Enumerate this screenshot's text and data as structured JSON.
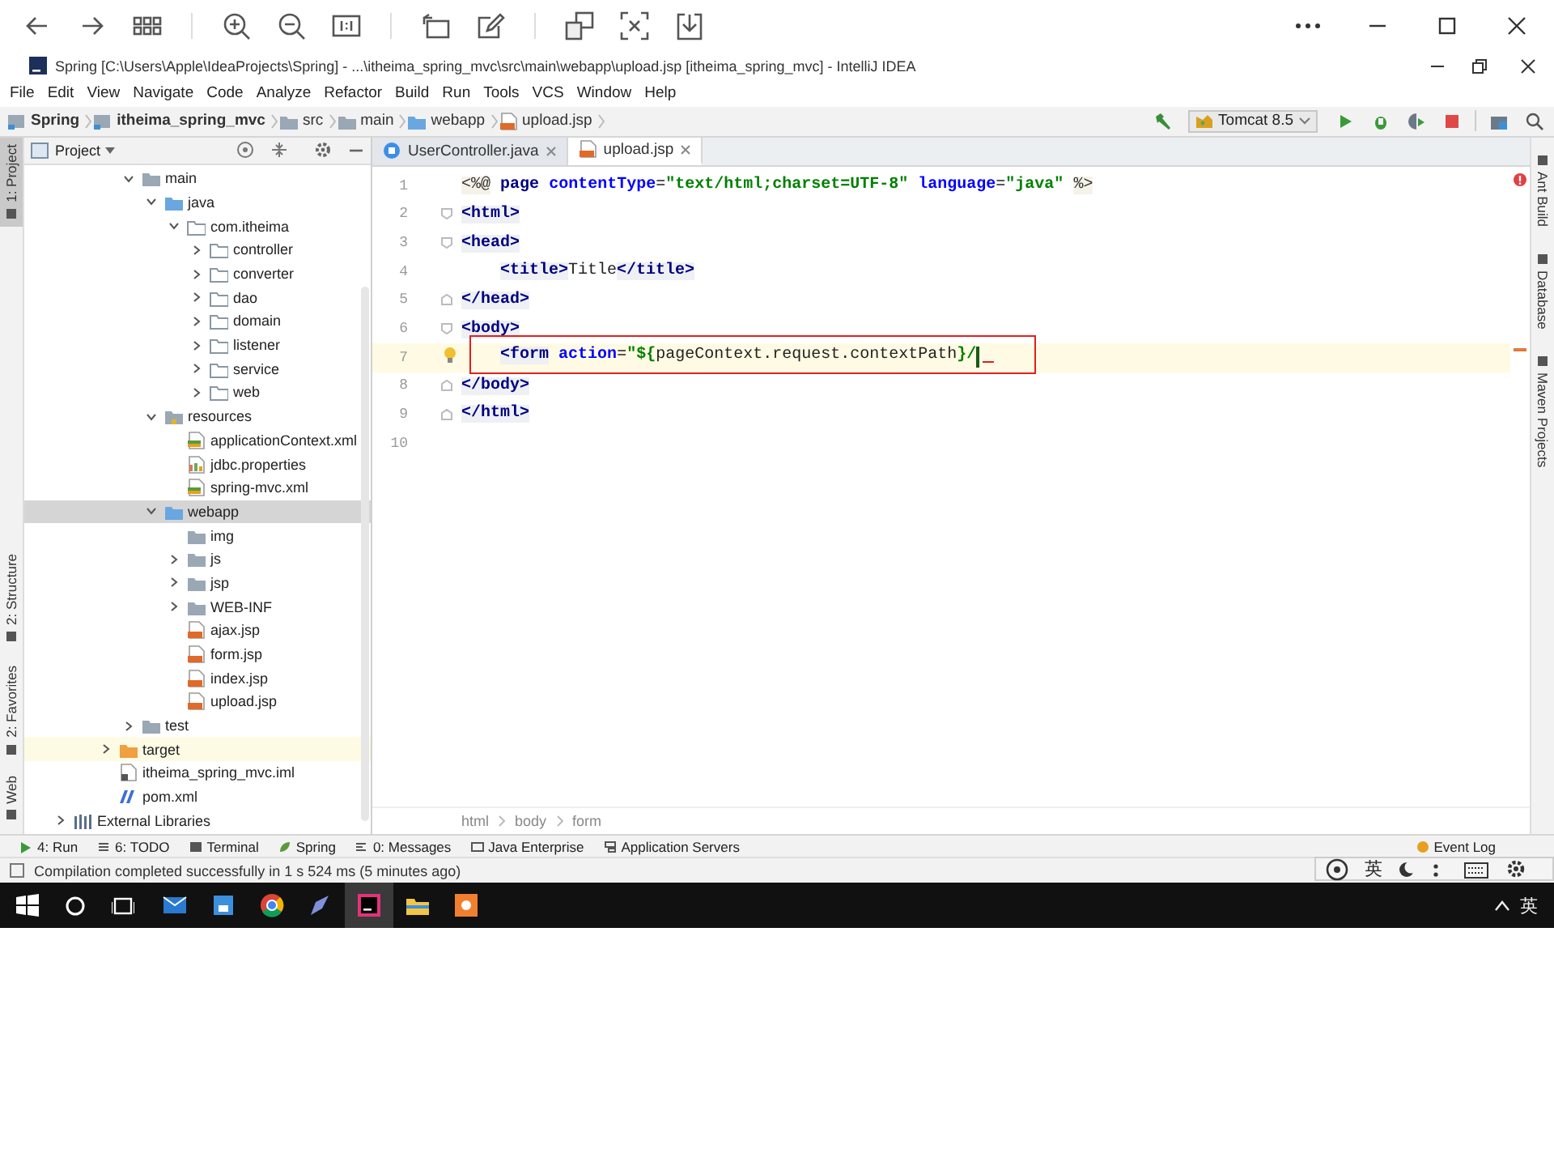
{
  "window": {
    "title": "Spring [C:\\Users\\Apple\\IdeaProjects\\Spring] - ...\\itheima_spring_mvc\\src\\main\\webapp\\upload.jsp [itheima_spring_mvc] - IntelliJ IDEA"
  },
  "menu": [
    "File",
    "Edit",
    "View",
    "Navigate",
    "Code",
    "Analyze",
    "Refactor",
    "Build",
    "Run",
    "Tools",
    "VCS",
    "Window",
    "Help"
  ],
  "breadcrumb": [
    {
      "label": "Spring",
      "kind": "module"
    },
    {
      "label": "itheima_spring_mvc",
      "kind": "module"
    },
    {
      "label": "src",
      "kind": "folder"
    },
    {
      "label": "main",
      "kind": "folder"
    },
    {
      "label": "webapp",
      "kind": "web"
    },
    {
      "label": "upload.jsp",
      "kind": "jsp"
    }
  ],
  "run_config": {
    "label": "Tomcat 8.5"
  },
  "left_tool_tabs": [
    {
      "label": "1: Project",
      "selected": true
    },
    {
      "label": "2: Structure",
      "selected": false
    },
    {
      "label": "2: Favorites",
      "selected": false
    },
    {
      "label": "Web",
      "selected": false
    }
  ],
  "right_tool_tabs": [
    {
      "label": "Ant Build"
    },
    {
      "label": "Database"
    },
    {
      "label": "Maven Projects"
    }
  ],
  "project_panel": {
    "title": "Project",
    "src_items": [
      {
        "label": "main",
        "kind": "folder",
        "expanded": true,
        "selected": false,
        "children": [
          {
            "label": "java",
            "kind": "source",
            "expanded": true,
            "selected": false,
            "children": [
              {
                "label": "com.itheima",
                "kind": "package",
                "expanded": true,
                "selected": false,
                "children": [
                  {
                    "label": "controller",
                    "kind": "package",
                    "expanded": false,
                    "selected": false
                  },
                  {
                    "label": "converter",
                    "kind": "package",
                    "expanded": false,
                    "selected": false
                  },
                  {
                    "label": "dao",
                    "kind": "package",
                    "expanded": false,
                    "selected": false
                  },
                  {
                    "label": "domain",
                    "kind": "package",
                    "expanded": false,
                    "selected": false
                  },
                  {
                    "label": "listener",
                    "kind": "package",
                    "expanded": false,
                    "selected": false
                  },
                  {
                    "label": "service",
                    "kind": "package",
                    "expanded": false,
                    "selected": false
                  },
                  {
                    "label": "web",
                    "kind": "package",
                    "expanded": false,
                    "selected": false
                  }
                ]
              }
            ]
          },
          {
            "label": "resources",
            "kind": "resources",
            "expanded": true,
            "selected": false,
            "children": [
              {
                "label": "applicationContext.xml",
                "kind": "xml",
                "selected": false
              },
              {
                "label": "jdbc.properties",
                "kind": "properties",
                "selected": false
              },
              {
                "label": "spring-mvc.xml",
                "kind": "xml",
                "selected": false
              }
            ]
          },
          {
            "label": "webapp",
            "kind": "web",
            "expanded": true,
            "selected": true,
            "children": [
              {
                "label": "img",
                "kind": "folder",
                "selected": false
              },
              {
                "label": "js",
                "kind": "folder",
                "expanded": false,
                "selected": false
              },
              {
                "label": "jsp",
                "kind": "folder",
                "expanded": false,
                "selected": false
              },
              {
                "label": "WEB-INF",
                "kind": "folder",
                "expanded": false,
                "selected": false
              },
              {
                "label": "ajax.jsp",
                "kind": "jsp",
                "selected": false
              },
              {
                "label": "form.jsp",
                "kind": "jsp",
                "selected": false
              },
              {
                "label": "index.jsp",
                "kind": "jsp",
                "selected": false
              },
              {
                "label": "upload.jsp",
                "kind": "jsp",
                "selected": false
              }
            ]
          }
        ]
      },
      {
        "label": "test",
        "kind": "folder",
        "expanded": false,
        "selected": false
      }
    ],
    "module_items": [
      {
        "label": "target",
        "kind": "excluded",
        "expanded": false,
        "selected": false
      },
      {
        "label": "itheima_spring_mvc.iml",
        "kind": "iml",
        "selected": false
      },
      {
        "label": "pom.xml",
        "kind": "pom",
        "selected": false
      }
    ],
    "root_items": [
      {
        "label": "External Libraries",
        "kind": "libraries",
        "expanded": false,
        "selected": false
      }
    ]
  },
  "editor": {
    "tabs": [
      {
        "label": "UserController.java",
        "kind": "java",
        "selected": false
      },
      {
        "label": "upload.jsp",
        "kind": "jsp",
        "selected": true
      }
    ],
    "lines": [
      {
        "number": "1",
        "fold_start": false,
        "fold_end": false,
        "current": false,
        "framed": false,
        "bulb": false,
        "error": false,
        "tokens": [
          {
            "kind": "directive",
            "t": "<%@"
          },
          {
            "kind": "keyword",
            "t": " page"
          },
          {
            "kind": "attribute",
            "t": " contentType"
          },
          {
            "kind": "plain",
            "t": "="
          },
          {
            "kind": "string",
            "t": "\"text/html;charset=UTF-8\""
          },
          {
            "kind": "attribute",
            "t": " language"
          },
          {
            "kind": "plain",
            "t": "="
          },
          {
            "kind": "string",
            "t": "\"java\""
          },
          {
            "kind": "directive",
            "t": " %>"
          }
        ]
      },
      {
        "number": "2",
        "fold_start": true,
        "fold_end": false,
        "current": false,
        "framed": false,
        "bulb": false,
        "error": false,
        "tokens": [
          {
            "kind": "tag",
            "t": "<html>"
          }
        ]
      },
      {
        "number": "3",
        "fold_start": true,
        "fold_end": false,
        "current": false,
        "framed": false,
        "bulb": false,
        "error": false,
        "tokens": [
          {
            "kind": "tag",
            "t": "<head>"
          }
        ]
      },
      {
        "number": "4",
        "fold_start": false,
        "fold_end": false,
        "current": false,
        "framed": false,
        "bulb": false,
        "error": false,
        "tokens": [
          {
            "kind": "tag",
            "t": "    <title>"
          },
          {
            "kind": "plain",
            "t": "Title"
          },
          {
            "kind": "tag",
            "t": "</title>"
          }
        ]
      },
      {
        "number": "5",
        "fold_start": false,
        "fold_end": true,
        "current": false,
        "framed": false,
        "bulb": false,
        "error": false,
        "tokens": [
          {
            "kind": "tag",
            "t": "</head>"
          }
        ]
      },
      {
        "number": "6",
        "fold_start": true,
        "fold_end": false,
        "current": false,
        "framed": false,
        "bulb": false,
        "error": false,
        "tokens": [
          {
            "kind": "tag",
            "t": "<body>"
          }
        ]
      },
      {
        "number": "7",
        "fold_start": false,
        "fold_end": false,
        "current": true,
        "framed": true,
        "bulb": true,
        "error": true,
        "tokens": [
          {
            "kind": "tag",
            "t": "    <form"
          },
          {
            "kind": "attribute",
            "t": " action"
          },
          {
            "kind": "plain",
            "t": "="
          },
          {
            "kind": "string",
            "t": "\"${"
          },
          {
            "kind": "plain",
            "t": "pageContext.request.contextPath"
          },
          {
            "kind": "string",
            "t": "}/"
          }
        ]
      },
      {
        "number": "8",
        "fold_start": false,
        "fold_end": true,
        "current": false,
        "framed": false,
        "bulb": false,
        "error": false,
        "tokens": [
          {
            "kind": "tag",
            "t": "</body>"
          }
        ]
      },
      {
        "number": "9",
        "fold_start": false,
        "fold_end": true,
        "current": false,
        "framed": false,
        "bulb": false,
        "error": false,
        "tokens": [
          {
            "kind": "tag",
            "t": "</html>"
          }
        ]
      },
      {
        "number": "10",
        "fold_start": false,
        "fold_end": false,
        "current": false,
        "framed": false,
        "bulb": false,
        "error": false
      }
    ],
    "breadcrumb": [
      "html",
      "body",
      "form"
    ]
  },
  "tool_windows": [
    {
      "label": "4: Run",
      "kind": "run"
    },
    {
      "label": "6: TODO",
      "kind": "todo"
    },
    {
      "label": "Terminal",
      "kind": "terminal"
    },
    {
      "label": "Spring",
      "kind": "spring"
    },
    {
      "label": "0: Messages",
      "kind": "messages"
    },
    {
      "label": "Java Enterprise",
      "kind": "enterprise"
    },
    {
      "label": "Application Servers",
      "kind": "servers"
    },
    {
      "label": "Event Log",
      "kind": "log"
    }
  ],
  "status": "Compilation completed successfully in 1 s 524 ms (5 minutes ago)",
  "ime_bar": {
    "label": "英"
  },
  "taskbar": {
    "apps": [
      {
        "kind": "mail",
        "selected": false
      },
      {
        "kind": "store",
        "selected": false
      },
      {
        "kind": "chrome",
        "selected": false
      },
      {
        "kind": "pen",
        "selected": false
      },
      {
        "kind": "idea",
        "selected": true
      },
      {
        "kind": "explorer",
        "selected": false
      },
      {
        "kind": "paint",
        "selected": false
      }
    ],
    "input_language": "英"
  }
}
